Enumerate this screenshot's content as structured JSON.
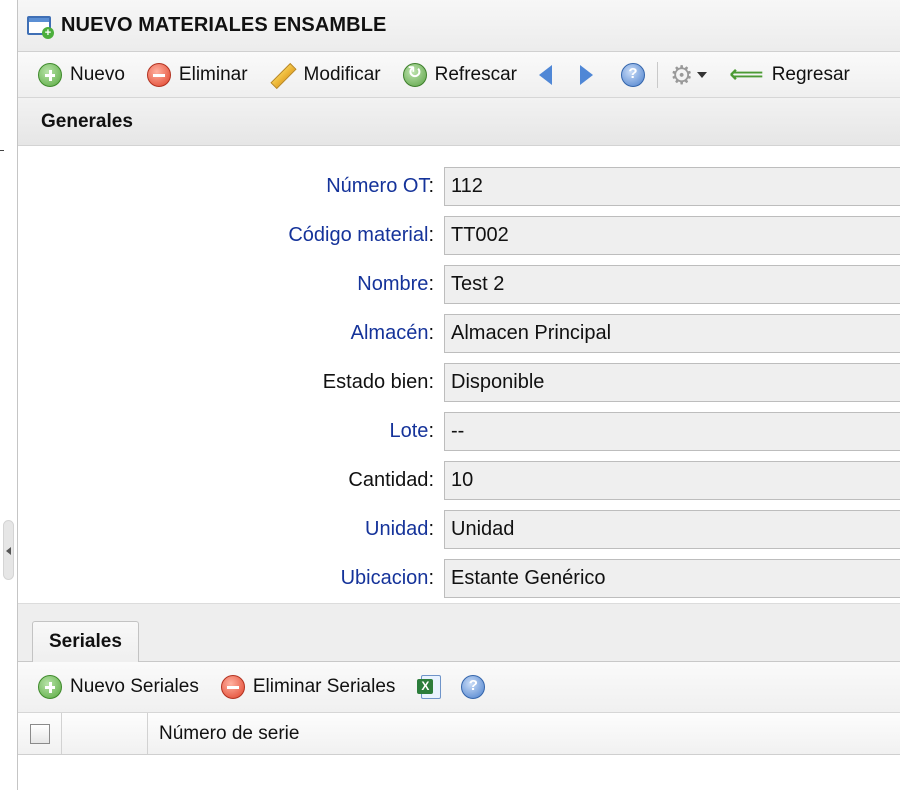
{
  "window": {
    "title": "NUEVO MATERIALES ENSAMBLE"
  },
  "toolbar": {
    "nuevo_label": "Nuevo",
    "eliminar_label": "Eliminar",
    "modificar_label": "Modificar",
    "refrescar_label": "Refrescar",
    "regresar_label": "Regresar"
  },
  "section": {
    "title": "Generales"
  },
  "form": {
    "fields": [
      {
        "label": "Número OT",
        "value": "112",
        "required": true
      },
      {
        "label": "Código material",
        "value": "TT002",
        "required": true
      },
      {
        "label": "Nombre",
        "value": "Test 2",
        "required": true
      },
      {
        "label": "Almacén",
        "value": "Almacen Principal",
        "required": true
      },
      {
        "label": "Estado bien",
        "value": "Disponible",
        "required": false
      },
      {
        "label": "Lote",
        "value": "--",
        "required": true
      },
      {
        "label": "Cantidad",
        "value": "10",
        "required": false
      },
      {
        "label": "Unidad",
        "value": "Unidad",
        "required": true
      },
      {
        "label": "Ubicacion",
        "value": "Estante Genérico",
        "required": true
      }
    ],
    "colon": ":"
  },
  "tabs": {
    "active_label": "Seriales"
  },
  "seriales_toolbar": {
    "nuevo_label": "Nuevo Seriales",
    "eliminar_label": "Eliminar Seriales"
  },
  "grid": {
    "columns": [
      "Número de serie"
    ]
  },
  "colors": {
    "required_label": "#15339a",
    "field_bg": "#efefef"
  },
  "icons": {
    "window": "window-add-icon",
    "nuevo": "add-icon",
    "eliminar": "delete-icon",
    "modificar": "pencil-icon",
    "refrescar": "refresh-icon",
    "prev": "arrow-left-icon",
    "next": "arrow-right-icon",
    "help": "help-icon",
    "settings": "gear-icon",
    "regresar": "back-arrow-icon",
    "export": "excel-icon"
  }
}
